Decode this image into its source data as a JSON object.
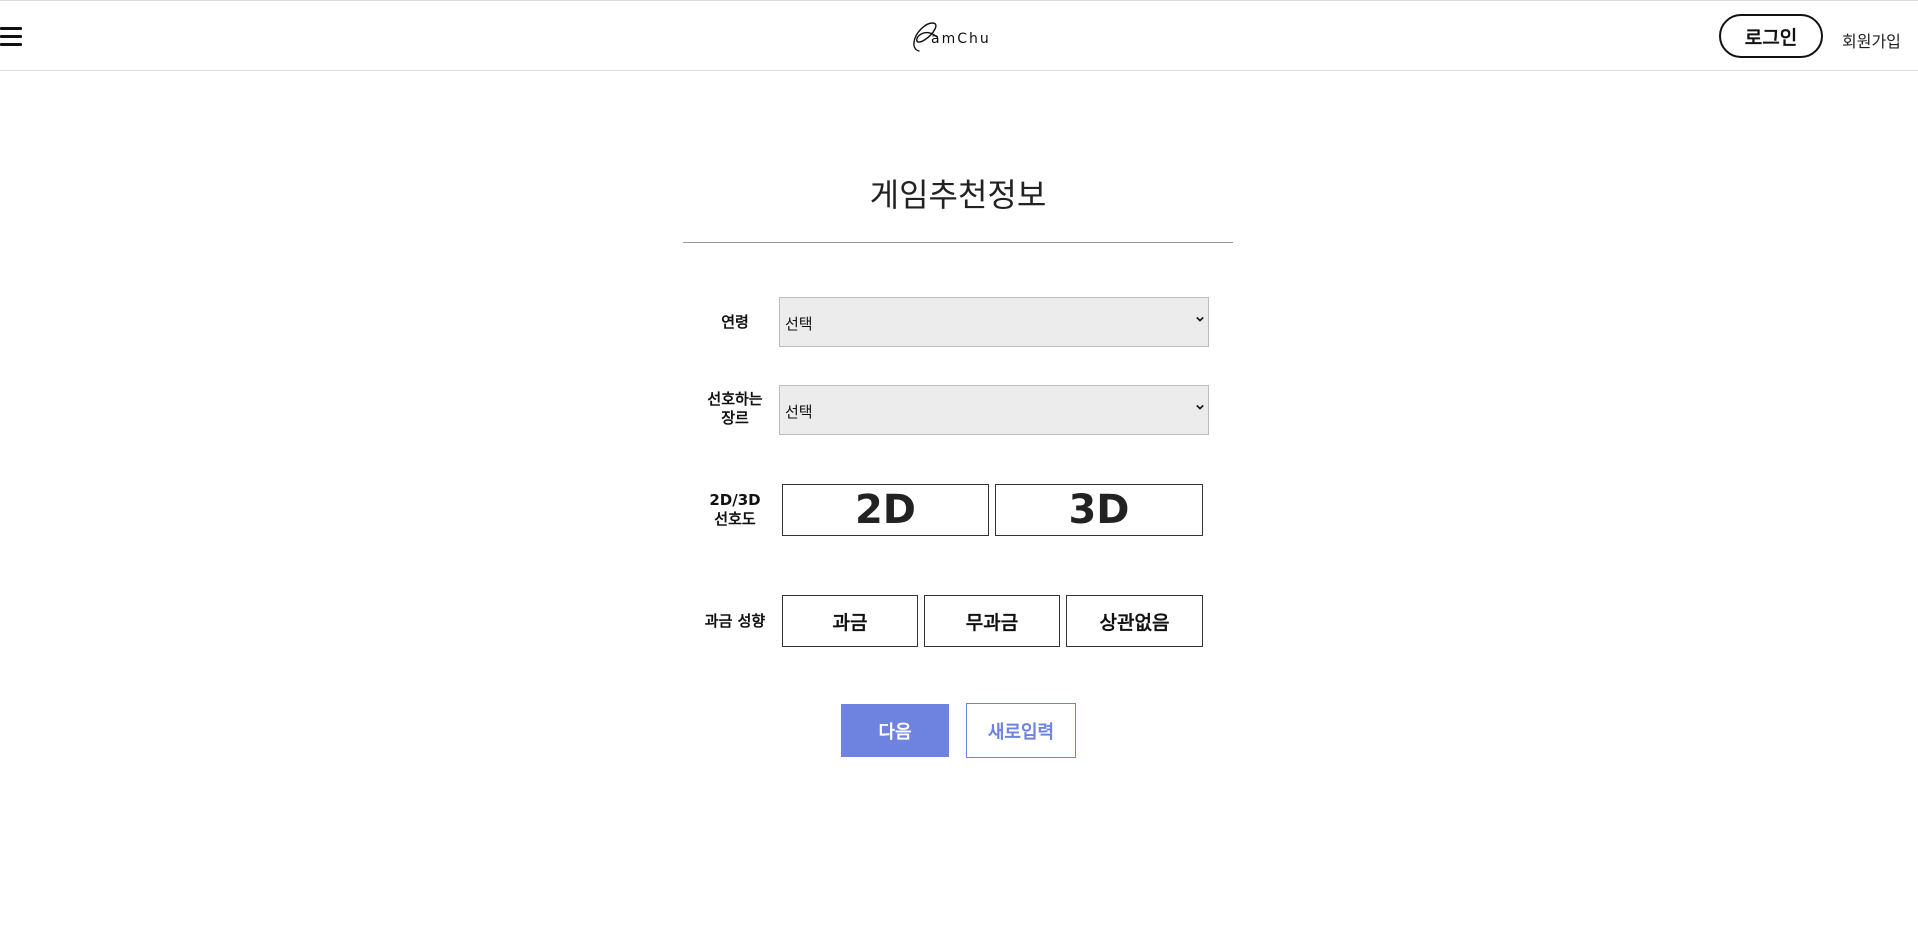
{
  "header": {
    "logo_text": "amChu",
    "login_label": "로그인",
    "signup_label": "회원가입"
  },
  "form": {
    "title": "게임추천정보",
    "age": {
      "label": "연령",
      "selected": "선택"
    },
    "genre": {
      "label_line1": "선호하는",
      "label_line2": "장르",
      "selected": "선택"
    },
    "dimension": {
      "label_line1": "2D/3D",
      "label_line2": "선호도",
      "options": [
        "2D",
        "3D"
      ]
    },
    "payment": {
      "label": "과금 성향",
      "options": [
        "과금",
        "무과금",
        "상관없음"
      ]
    },
    "actions": {
      "next_label": "다음",
      "reset_label": "새로입력"
    }
  },
  "colors": {
    "accent": "#6e83df",
    "select_bg": "#ececec"
  },
  "icons": {
    "menu": "hamburger-menu-icon",
    "select_arrow": "chevron-down-icon"
  }
}
